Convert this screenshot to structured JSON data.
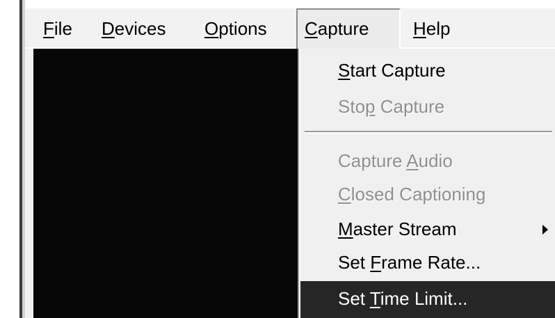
{
  "menubar": {
    "items": [
      {
        "label": "File",
        "mnemonic": "F",
        "rest": "ile"
      },
      {
        "label": "Devices",
        "mnemonic": "D",
        "rest": "evices"
      },
      {
        "label": "Options",
        "mnemonic": "O",
        "rest": "ptions"
      },
      {
        "label": "Capture",
        "mnemonic": "C",
        "rest": "apture"
      },
      {
        "label": "Help",
        "mnemonic": "H",
        "rest": "elp"
      }
    ]
  },
  "capture_menu": {
    "items": [
      {
        "pre": "",
        "mnemonic": "S",
        "post": "tart Capture",
        "enabled": true
      },
      {
        "pre": "Sto",
        "mnemonic": "p",
        "post": " Capture",
        "enabled": false
      },
      {
        "pre": "Capture ",
        "mnemonic": "A",
        "post": "udio",
        "enabled": false
      },
      {
        "pre": "",
        "mnemonic": "C",
        "post": "losed Captioning",
        "enabled": false
      },
      {
        "pre": "",
        "mnemonic": "M",
        "post": "aster Stream",
        "enabled": true,
        "submenu_icon": "submenu-arrow-icon"
      },
      {
        "pre": "Set ",
        "mnemonic": "F",
        "post": "rame Rate...",
        "enabled": true
      },
      {
        "pre": "Set ",
        "mnemonic": "T",
        "post": "ime Limit...",
        "enabled": true,
        "highlighted": true
      }
    ]
  },
  "colors": {
    "video_background": "#070707",
    "menu_background": "#f0f0f0",
    "highlight": "#262626",
    "disabled_text": "#8f8f8f"
  }
}
